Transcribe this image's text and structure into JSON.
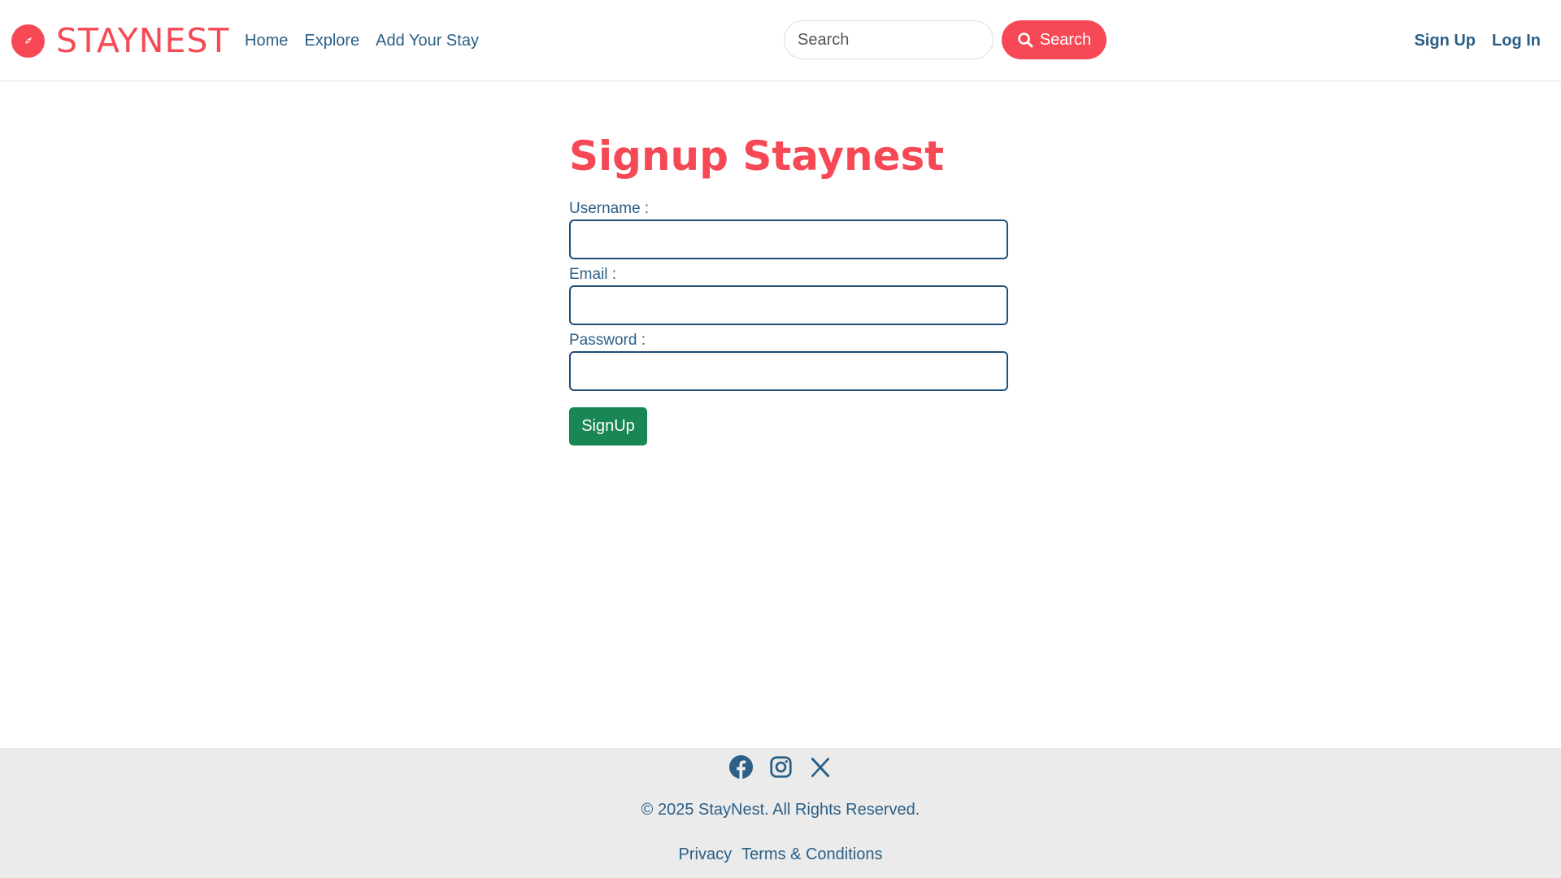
{
  "colors": {
    "brand": "#f74855",
    "text": "#2b5f85",
    "success": "#198754",
    "footer_bg": "#ebebeb"
  },
  "navbar": {
    "brand": {
      "name": "STAYNEST",
      "icon": "compass-icon"
    },
    "links": [
      {
        "label": "Home"
      },
      {
        "label": "Explore"
      },
      {
        "label": "Add Your Stay"
      }
    ],
    "search": {
      "placeholder": "Search",
      "value": "",
      "button_label": "Search",
      "button_icon": "search-icon"
    },
    "auth": {
      "signup_label": "Sign Up",
      "login_label": "Log In"
    }
  },
  "main": {
    "title": "Signup Staynest",
    "fields": [
      {
        "label": "Username :",
        "value": ""
      },
      {
        "label": "Email :",
        "value": ""
      },
      {
        "label": "Password :",
        "value": ""
      }
    ],
    "submit_label": "SignUp"
  },
  "footer": {
    "socials": [
      "facebook-icon",
      "instagram-icon",
      "x-icon"
    ],
    "copyright": "© 2025 StayNest. All Rights Reserved.",
    "links": [
      {
        "label": "Privacy"
      },
      {
        "label": "Terms & Conditions"
      }
    ]
  }
}
